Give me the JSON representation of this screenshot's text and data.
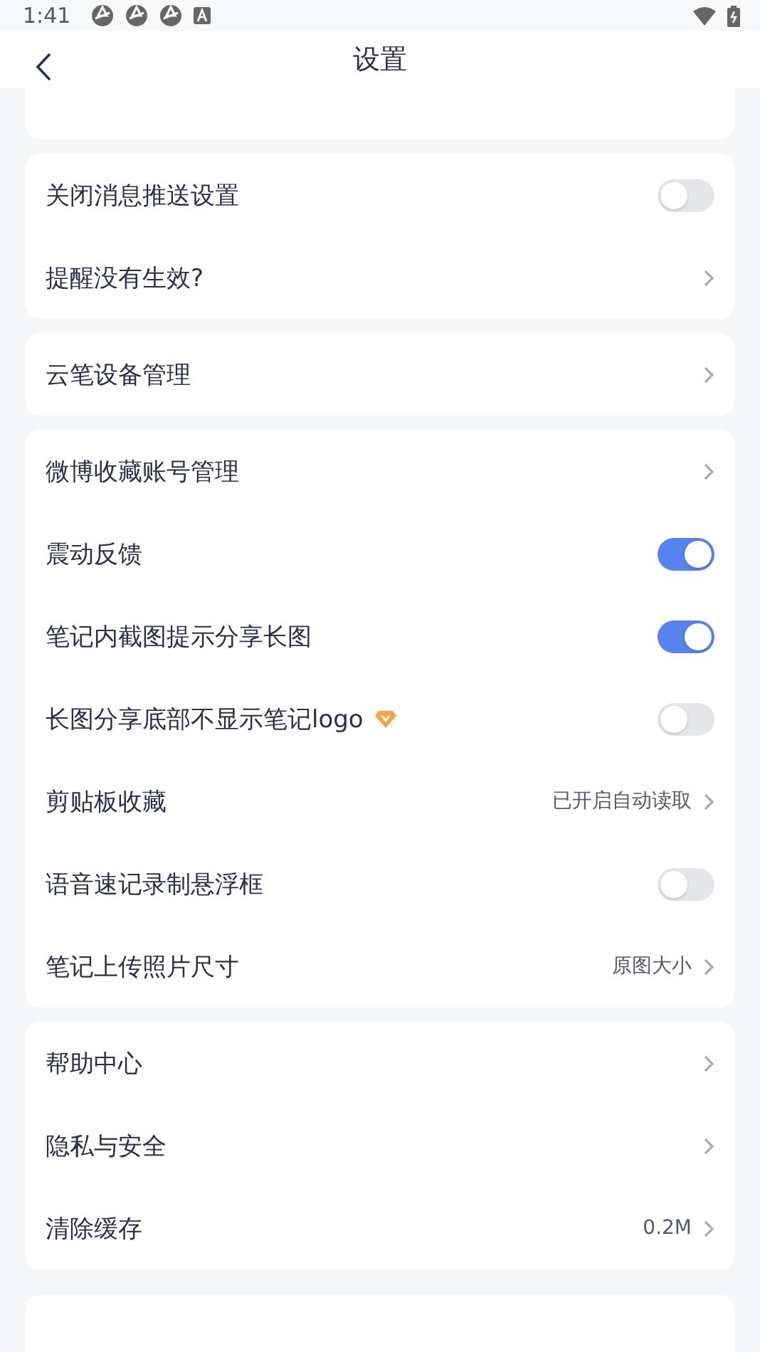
{
  "status_bar": {
    "time": "1:41"
  },
  "header": {
    "title": "设置"
  },
  "groups": [
    {
      "rows": [
        {
          "kind": "toggle",
          "label": "关闭消息推送设置",
          "on": false
        },
        {
          "kind": "link",
          "label": "提醒没有生效?"
        }
      ]
    },
    {
      "rows": [
        {
          "kind": "link",
          "label": "云笔设备管理"
        }
      ]
    },
    {
      "rows": [
        {
          "kind": "link",
          "label": "微博收藏账号管理"
        },
        {
          "kind": "toggle",
          "label": "震动反馈",
          "on": true
        },
        {
          "kind": "toggle",
          "label": "笔记内截图提示分享长图",
          "on": true
        },
        {
          "kind": "toggle",
          "label": "长图分享底部不显示笔记logo",
          "on": false,
          "premium": true
        },
        {
          "kind": "link",
          "label": "剪贴板收藏",
          "value": "已开启自动读取"
        },
        {
          "kind": "toggle",
          "label": "语音速记录制悬浮框",
          "on": false
        },
        {
          "kind": "link",
          "label": "笔记上传照片尺寸",
          "value": "原图大小"
        }
      ]
    },
    {
      "rows": [
        {
          "kind": "link",
          "label": "帮助中心"
        },
        {
          "kind": "link",
          "label": "隐私与安全"
        },
        {
          "kind": "link",
          "label": "清除缓存",
          "value": "0.2M"
        }
      ]
    }
  ]
}
